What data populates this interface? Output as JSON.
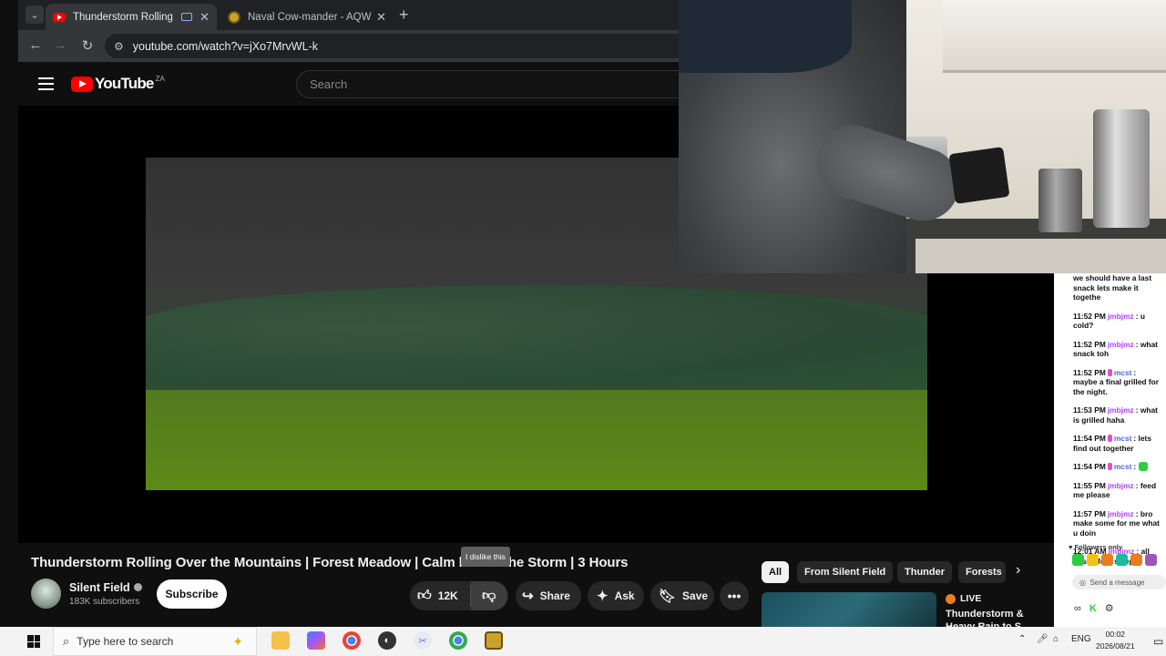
{
  "browser": {
    "tabs": [
      {
        "title": "Thunderstorm Rolling Over",
        "active": true
      },
      {
        "title": "Naval Cow-mander - AQW",
        "active": false
      }
    ],
    "url": "youtube.com/watch?v=jXo7MrvWL-k"
  },
  "youtube": {
    "logo_text": "YouTube",
    "country_code": "ZA",
    "search_placeholder": "Search"
  },
  "video": {
    "title": "Thunderstorm Rolling Over the Mountains | Forest Meadow | Calm before the Storm | 3 Hours",
    "tooltip": "I dislike this",
    "channel": "Silent Field",
    "subscribers": "183K subscribers",
    "subscribe_label": "Subscribe",
    "likes": "12K",
    "share_label": "Share",
    "ask_label": "Ask",
    "save_label": "Save"
  },
  "chat": {
    "messages": [
      {
        "time": "",
        "user": "",
        "text": "we should have a last snack lets make it togethe"
      },
      {
        "time": "11:52 PM",
        "user": "jmbjmz",
        "text": "u cold?"
      },
      {
        "time": "11:52 PM",
        "user": "jmbjmz",
        "text": "what snack toh"
      },
      {
        "time": "11:52 PM",
        "user": "mcst",
        "mod": true,
        "text": "maybe a final grilled for the night."
      },
      {
        "time": "11:53 PM",
        "user": "jmbjmz",
        "text": "what is grilled haha"
      },
      {
        "time": "11:54 PM",
        "user": "mcst",
        "mod": true,
        "text": "lets find out together"
      },
      {
        "time": "11:54 PM",
        "user": "mcst",
        "mod": true,
        "text": "",
        "emote": true
      },
      {
        "time": "11:55 PM",
        "user": "jmbjmz",
        "text": "feed me please"
      },
      {
        "time": "11:57 PM",
        "user": "jmbjmz",
        "text": "bro make some for me what u doin"
      },
      {
        "time": "12:01 AM",
        "user": "jmbjmz",
        "text": "all this before sleep?"
      }
    ],
    "followers_only": "Followers only",
    "send_placeholder": "Send a message"
  },
  "recommendations": {
    "chips": [
      "All",
      "From Silent Field",
      "Thunder",
      "Forests"
    ],
    "live_label": "LIVE",
    "first_title": "Thunderstorm & Heavy Rain to S"
  },
  "taskbar": {
    "search_placeholder": "Type here to search",
    "language": "ENG",
    "time": "00:02",
    "date": "2026/08/21"
  }
}
